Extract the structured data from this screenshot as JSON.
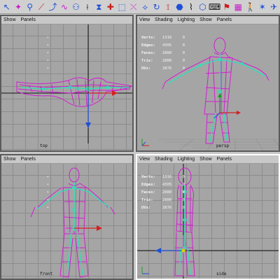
{
  "shelf": {
    "tools": [
      {
        "icon": "select-tool-icon",
        "glyph": "↖",
        "color": "#1f4fd8"
      },
      {
        "icon": "figure-icon",
        "glyph": "✦",
        "color": "#c81ec8"
      },
      {
        "icon": "joint-icon",
        "glyph": "⚲",
        "color": "#1f4fd8"
      },
      {
        "icon": "bone-chain-icon",
        "glyph": "⟋",
        "color": "#c81e1e"
      },
      {
        "icon": "ik-handle-icon",
        "glyph": "⤴",
        "color": "#1f4fd8"
      },
      {
        "icon": "spline-ik-icon",
        "glyph": "∿",
        "color": "#c81ec8"
      },
      {
        "icon": "skin-icon",
        "glyph": "⚇",
        "color": "#1f4fd8"
      },
      {
        "icon": "paint-weights-icon",
        "glyph": "⟊",
        "color": "#111111"
      },
      {
        "icon": "bind-icon",
        "glyph": "⧗",
        "color": "#1f4fd8"
      },
      {
        "icon": "cluster-icon",
        "glyph": "✚",
        "color": "#c81e1e"
      },
      {
        "icon": "lattice-icon",
        "glyph": "⬚",
        "color": "#1f4fd8"
      },
      {
        "icon": "constraint-icon",
        "glyph": "⤬",
        "color": "#c81ec8"
      },
      {
        "icon": "aim-icon",
        "glyph": "⟡",
        "color": "#1f4fd8"
      },
      {
        "icon": "orient-icon",
        "glyph": "↻",
        "color": "#1f4fd8"
      },
      {
        "icon": "pole-vector-icon",
        "glyph": "⟟",
        "color": "#c81e1e"
      },
      {
        "icon": "blend-shape-icon",
        "glyph": "⬣",
        "color": "#1f4fd8"
      },
      {
        "icon": "wire-icon",
        "glyph": "⌇",
        "color": "#111111"
      },
      {
        "icon": "wrap-icon",
        "glyph": "⬡",
        "color": "#1f4fd8"
      },
      {
        "icon": "keyboard-icon",
        "glyph": "⌨",
        "color": "#111111"
      },
      {
        "icon": "character-set-icon",
        "glyph": "⚑",
        "color": "#c81e1e"
      },
      {
        "icon": "palette-icon",
        "glyph": "▦",
        "color": "#c81ec8"
      },
      {
        "icon": "walk-icon",
        "glyph": "🚶",
        "color": "#1f4fd8"
      },
      {
        "icon": "run-icon",
        "glyph": "✶",
        "color": "#1f4fd8"
      },
      {
        "icon": "pose-icon",
        "glyph": "✈",
        "color": "#1f4fd8"
      }
    ]
  },
  "panes": {
    "tl": {
      "menu": [
        "Show",
        "Panels"
      ],
      "camera": "top"
    },
    "tr": {
      "menu": [
        "View",
        "Shading",
        "Lighting",
        "Show",
        "Panels"
      ],
      "camera": "persp"
    },
    "bl": {
      "menu": [
        "Show",
        "Panels"
      ],
      "camera": "front"
    },
    "br": {
      "menu": [
        "View",
        "Shading",
        "Lighting",
        "Show",
        "Panels"
      ],
      "camera": "side"
    }
  },
  "hud": {
    "rows": [
      {
        "label": "Verts:",
        "value": "1316",
        "col3": "0"
      },
      {
        "label": "Edges:",
        "value": "4305",
        "col3": "0"
      },
      {
        "label": "Faces:",
        "value": "2880",
        "col3": "0"
      },
      {
        "label": "Tris:",
        "value": "2880",
        "col3": "0"
      },
      {
        "label": "UVs:",
        "value": "2876",
        "col3": "0"
      }
    ],
    "empty_rows": 5
  },
  "colors": {
    "mesh": "#d21ed2",
    "skeleton": "#2de0b8",
    "axis_x": "#d42020",
    "axis_y": "#1f4fd8",
    "axis_z": "#1aa01a",
    "grid": "#8c8c8c",
    "viewport": "#a5a5a5",
    "active_border": "#ffffff"
  }
}
